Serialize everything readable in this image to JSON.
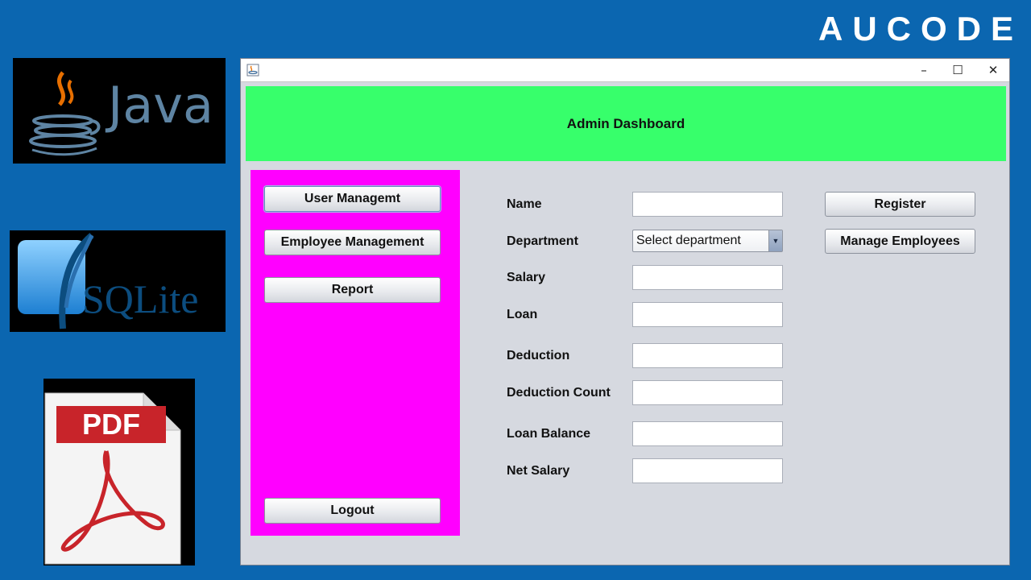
{
  "brand": "AUCODE",
  "java_logo": {
    "text": "Java"
  },
  "sqlite_logo": {
    "text": "SQLite"
  },
  "pdf_logo": {
    "text": "PDF"
  },
  "window": {
    "controls": {
      "minimize": "–",
      "maximize": "☐",
      "close": "✕"
    }
  },
  "header": {
    "title": "Admin Dashboard"
  },
  "sidebar": {
    "user_management": "User Managemt",
    "employee_management": "Employee Management",
    "report": "Report",
    "logout": "Logout"
  },
  "form": {
    "name_label": "Name",
    "name_value": "",
    "department_label": "Department",
    "department_selected": "Select department",
    "salary_label": "Salary",
    "salary_value": "",
    "loan_label": "Loan",
    "loan_value": "",
    "deduction_label": "Deduction",
    "deduction_value": "",
    "deduction_count_label": "Deduction Count",
    "deduction_count_value": "",
    "loan_balance_label": "Loan Balance",
    "loan_balance_value": "",
    "net_salary_label": "Net Salary",
    "net_salary_value": ""
  },
  "actions": {
    "register": "Register",
    "manage_employees": "Manage Employees"
  },
  "colors": {
    "background": "#0b66b0",
    "header": "#37ff6b",
    "sidebar": "#ff00ff",
    "content": "#d6d9e0"
  }
}
